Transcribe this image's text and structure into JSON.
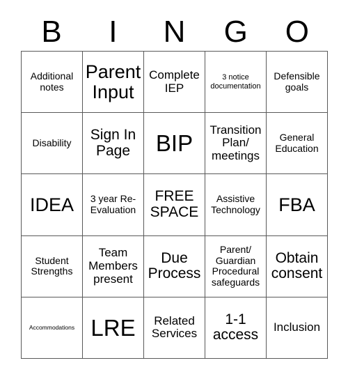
{
  "card": {
    "title": "BINGO",
    "header_letters": [
      "B",
      "I",
      "N",
      "G",
      "O"
    ],
    "colors": {
      "background": "#ffffff",
      "text": "#000000",
      "grid_line": "#595959"
    },
    "grid": {
      "rows": 5,
      "columns": 5,
      "free_space_row": 3,
      "free_space_column": 3
    },
    "cells": [
      {
        "text": "Additional notes",
        "size": "md"
      },
      {
        "text": "Parent Input",
        "size": "xxl"
      },
      {
        "text": "Complete IEP",
        "size": "lg"
      },
      {
        "text": "3 notice documentation",
        "size": "sm"
      },
      {
        "text": "Defensible goals",
        "size": "md"
      },
      {
        "text": "Disability",
        "size": "md"
      },
      {
        "text": "Sign In Page",
        "size": "xl"
      },
      {
        "text": "BIP",
        "size": "huge"
      },
      {
        "text": "Transition Plan/ meetings",
        "size": "lg"
      },
      {
        "text": "General Education",
        "size": "md"
      },
      {
        "text": "IDEA",
        "size": "xxl"
      },
      {
        "text": "3 year Re-Evaluation",
        "size": "md"
      },
      {
        "text": "FREE SPACE",
        "size": "xl"
      },
      {
        "text": "Assistive Technology",
        "size": "md"
      },
      {
        "text": "FBA",
        "size": "xxl"
      },
      {
        "text": "Student Strengths",
        "size": "md"
      },
      {
        "text": "Team Members present",
        "size": "lg"
      },
      {
        "text": "Due Process",
        "size": "xl"
      },
      {
        "text": "Parent/ Guardian Procedural safeguards",
        "size": "md"
      },
      {
        "text": "Obtain consent",
        "size": "xl"
      },
      {
        "text": "Accommodations",
        "size": "xs"
      },
      {
        "text": "LRE",
        "size": "huge"
      },
      {
        "text": "Related Services",
        "size": "lg"
      },
      {
        "text": "1-1 access",
        "size": "xl"
      },
      {
        "text": "Inclusion",
        "size": "lg"
      }
    ]
  }
}
